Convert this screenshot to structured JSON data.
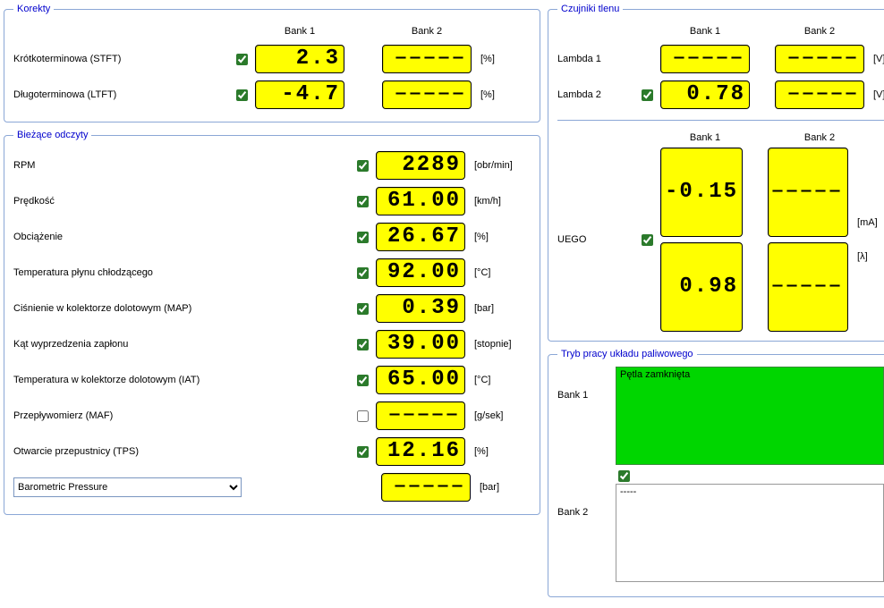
{
  "blank": "‒‒‒‒‒",
  "korekty": {
    "title": "Korekty",
    "bank1": "Bank 1",
    "bank2": "Bank 2",
    "stft_label": "Krótkoterminowa (STFT)",
    "stft_b1": "2.3",
    "stft_unit": "[%]",
    "ltft_label": "Długoterminowa (LTFT)",
    "ltft_b1": "-4.7",
    "ltft_unit": "[%]"
  },
  "readings": {
    "title": "Bieżące odczyty",
    "items": [
      {
        "label": "RPM",
        "val": "2289",
        "unit": "[obr/min]",
        "checked": true
      },
      {
        "label": "Prędkość",
        "val": "61.00",
        "unit": "[km/h]",
        "checked": true
      },
      {
        "label": "Obciążenie",
        "val": "26.67",
        "unit": "[%]",
        "checked": true
      },
      {
        "label": "Temperatura płynu chłodzącego",
        "val": "92.00",
        "unit": "[°C]",
        "checked": true
      },
      {
        "label": "Ciśnienie w kolektorze dolotowym (MAP)",
        "val": "0.39",
        "unit": "[bar]",
        "checked": true
      },
      {
        "label": "Kąt wyprzedzenia zapłonu",
        "val": "39.00",
        "unit": "[stopnie]",
        "checked": true
      },
      {
        "label": "Temperatura w kolektorze dolotowym (IAT)",
        "val": "65.00",
        "unit": "[°C]",
        "checked": true
      },
      {
        "label": "Przepływomierz (MAF)",
        "val": "‒‒‒‒‒",
        "unit": "[g/sek]",
        "checked": false
      },
      {
        "label": "Otwarcie przepustnicy (TPS)",
        "val": "12.16",
        "unit": "[%]",
        "checked": true
      }
    ],
    "custom_select": "Barometric Pressure",
    "custom_val": "‒‒‒‒‒",
    "custom_unit": "[bar]"
  },
  "oxygen": {
    "title": "Czujniki tlenu",
    "bank1": "Bank 1",
    "bank2": "Bank 2",
    "lambda1_label": "Lambda 1",
    "lambda1_unit": "[V]",
    "lambda2_label": "Lambda 2",
    "lambda2_b1": "0.78",
    "lambda2_unit": "[V]",
    "uego_label": "UEGO",
    "uego_b1_a": "-0.15",
    "uego_b1_b": "0.98",
    "uego_unit_a": "[mA]",
    "uego_unit_b": "[λ]"
  },
  "fuel": {
    "title": "Tryb pracy układu paliwowego",
    "bank1_label": "Bank 1",
    "bank1_text": "Pętla zamknięta",
    "bank2_label": "Bank 2",
    "bank2_text": "-----"
  }
}
